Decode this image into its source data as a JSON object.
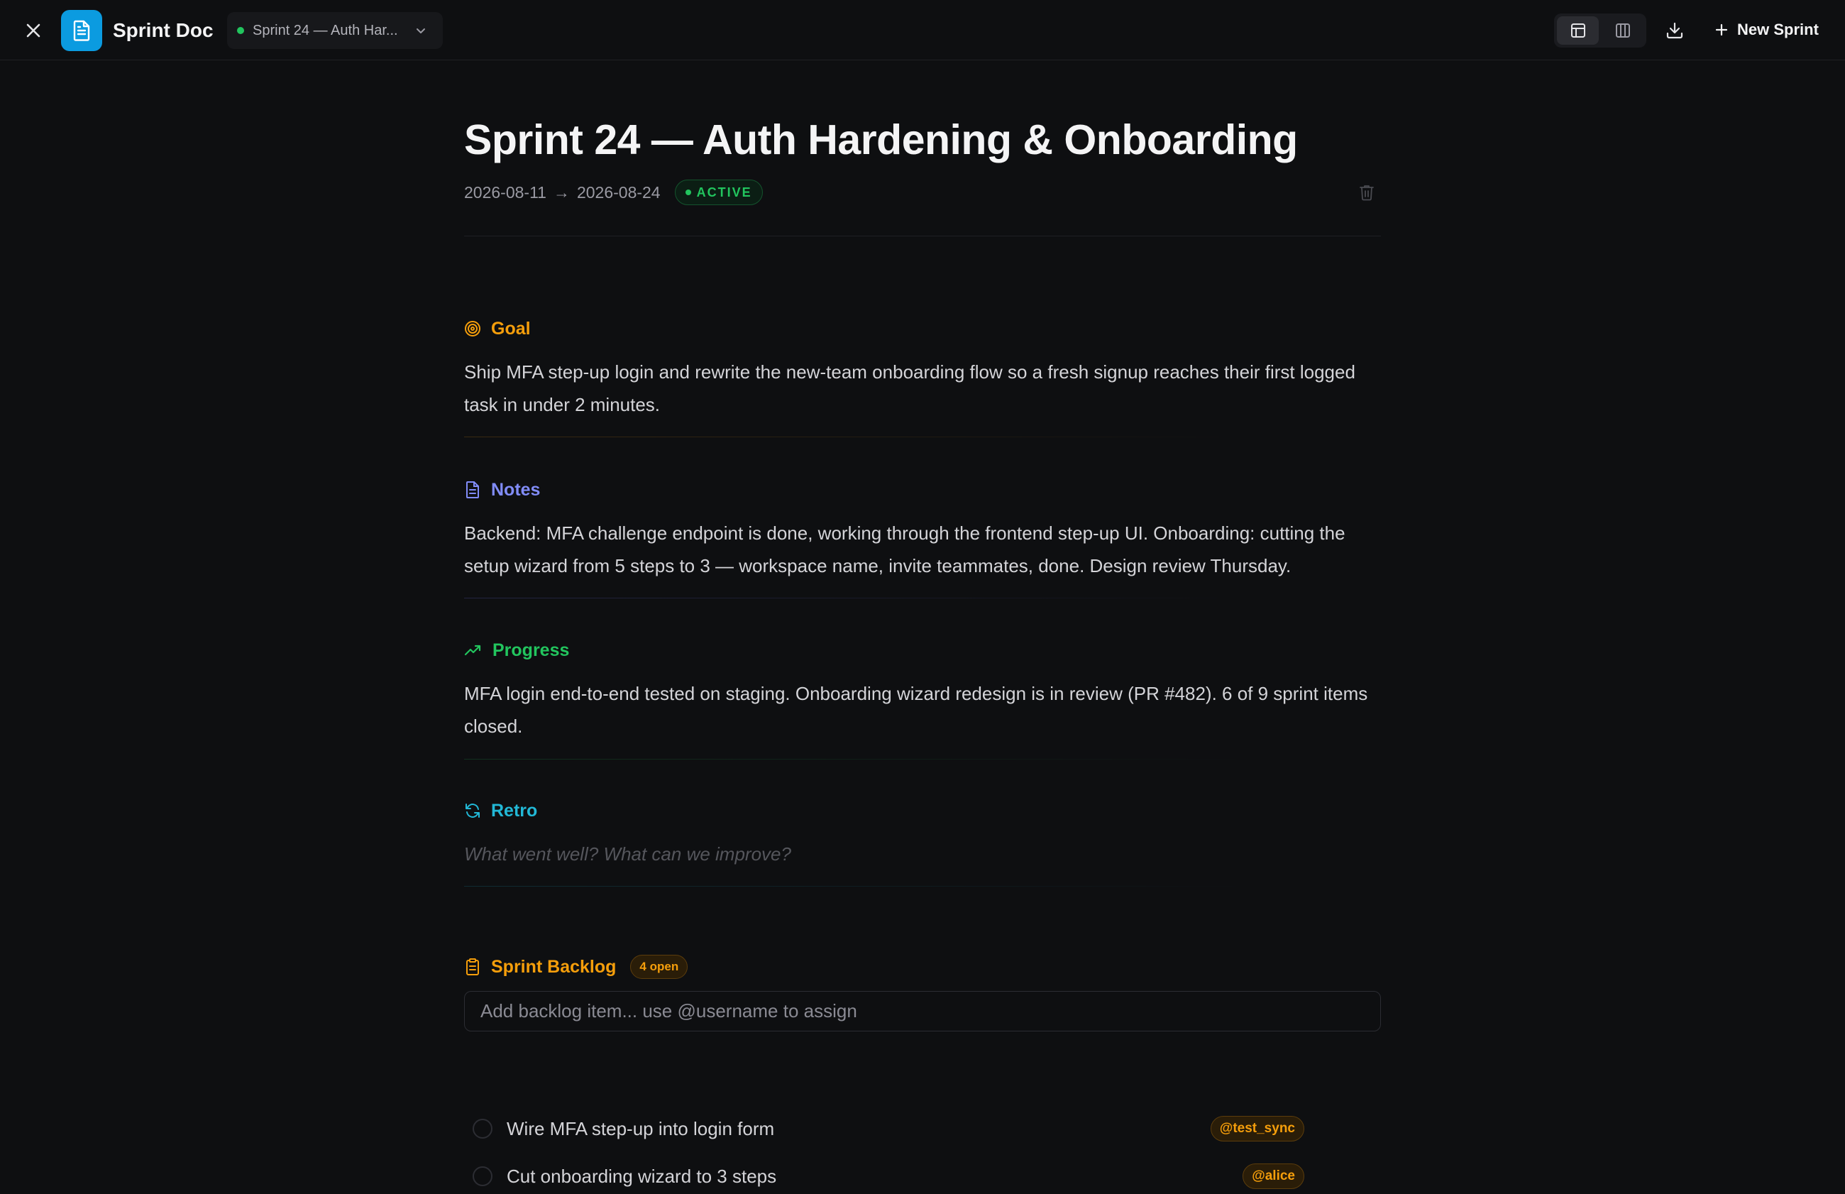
{
  "app": {
    "title": "Sprint Doc",
    "icon": "document-icon",
    "accent_color": "#0b9be0"
  },
  "sprint_selector": {
    "selected_label": "Sprint 24 — Auth Har...",
    "status_color": "#22c55e"
  },
  "toolbar": {
    "view_modes": [
      "single-panel-layout-icon",
      "split-columns-layout-icon"
    ],
    "active_view": "single-panel-layout-icon",
    "download_icon": "download-icon",
    "new_sprint_label": "New Sprint"
  },
  "sprint": {
    "title": "Sprint 24 — Auth Hardening & Onboarding",
    "start_date": "2026-08-11",
    "date_arrow": "→",
    "end_date": "2026-08-24",
    "status": "ACTIVE",
    "status_color": "#22c55e"
  },
  "sections": {
    "goal": {
      "heading": "Goal",
      "icon": "target-icon",
      "color": "#f59e0b",
      "body": "Ship MFA step-up login and rewrite the new-team onboarding flow so a fresh signup reaches their first logged task in under 2 minutes."
    },
    "notes": {
      "heading": "Notes",
      "icon": "document-icon",
      "color": "#818cf8",
      "body": "Backend: MFA challenge endpoint is done, working through the frontend step-up UI. Onboarding: cutting the setup wizard from 5 steps to 3 — workspace name, invite teammates, done. Design review Thursday."
    },
    "progress": {
      "heading": "Progress",
      "icon": "trending-up-icon",
      "color": "#22c55e",
      "body": "MFA login end-to-end tested on staging. Onboarding wizard redesign is in review (PR #482). 6 of 9 sprint items closed."
    },
    "retro": {
      "heading": "Retro",
      "icon": "refresh-icon",
      "color": "#22b8d6",
      "placeholder": "What went well? What can we improve?"
    }
  },
  "backlog": {
    "heading": "Sprint Backlog",
    "icon": "clipboard-icon",
    "color": "#f59e0b",
    "open_count_label": "4 open",
    "input_placeholder": "Add backlog item... use @username to assign",
    "items": [
      {
        "text": "Wire MFA step-up into login form",
        "assignee": "@test_sync",
        "done": false
      },
      {
        "text": "Cut onboarding wizard to 3 steps",
        "assignee": "@alice",
        "done": false
      }
    ]
  }
}
